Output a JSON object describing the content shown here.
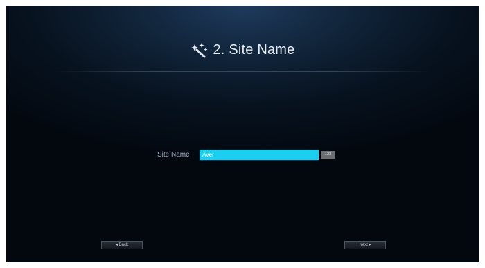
{
  "page": {
    "title": "2. Site Name",
    "title_icon": "magic-wand-icon"
  },
  "form": {
    "site_name_label": "Site Name",
    "site_name_value": "AVer",
    "keyboard_mode": "123"
  },
  "navigation": {
    "back_label": "◂ Back",
    "next_label": "Next ▸"
  },
  "colors": {
    "input_background": "#19d0f0",
    "background_top": "#1e3a5c",
    "background_bottom": "#03080f"
  }
}
